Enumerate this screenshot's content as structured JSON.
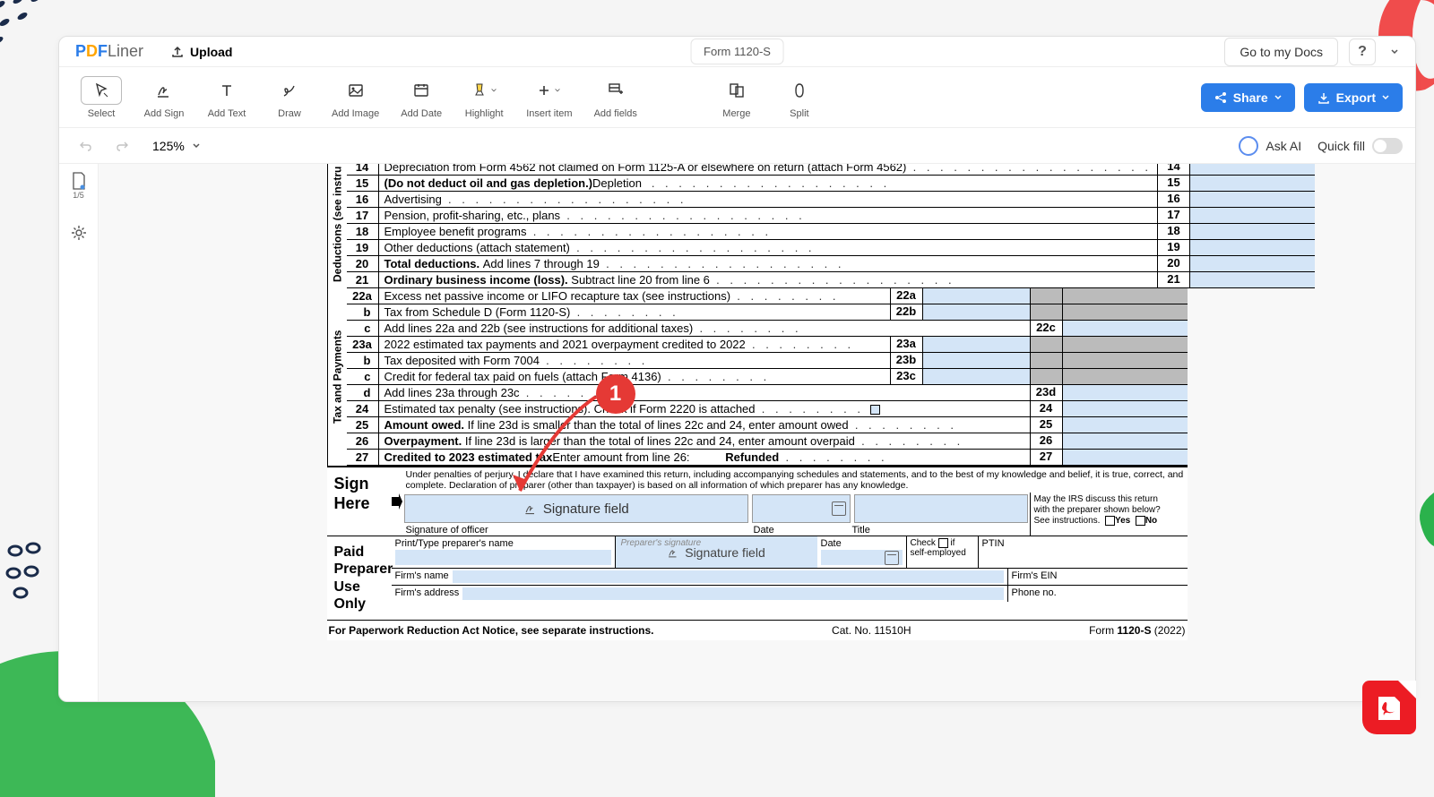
{
  "brand": {
    "p": "P",
    "d": "D",
    "f": "F",
    "liner": "Liner"
  },
  "topbar": {
    "upload": "Upload",
    "doc_title": "Form 1120-S",
    "go_docs": "Go to my Docs",
    "help": "?"
  },
  "toolbar": {
    "select": "Select",
    "add_sign": "Add Sign",
    "add_text": "Add Text",
    "draw": "Draw",
    "add_image": "Add Image",
    "add_date": "Add Date",
    "highlight": "Highlight",
    "insert_item": "Insert item",
    "add_fields": "Add fields",
    "merge": "Merge",
    "split": "Split",
    "share": "Share",
    "export": "Export"
  },
  "subbar": {
    "zoom": "125%",
    "ask_ai": "Ask AI",
    "quickfill": "Quick fill"
  },
  "leftbar": {
    "page_indicator": "1/5"
  },
  "form": {
    "sections": {
      "deductions": "Deductions  (see instru",
      "tax": "Tax and Payments"
    },
    "lines": [
      {
        "n": "14",
        "t": "Depreciation from Form 4562 not claimed on Form 1125-A or elsewhere on return (attach Form 4562)",
        "r": "14"
      },
      {
        "n": "15",
        "t": "Depletion ",
        "b": "(Do not deduct oil and gas depletion.)",
        "r": "15"
      },
      {
        "n": "16",
        "t": "Advertising",
        "r": "16"
      },
      {
        "n": "17",
        "t": "Pension, profit-sharing, etc., plans",
        "r": "17"
      },
      {
        "n": "18",
        "t": "Employee benefit programs",
        "r": "18"
      },
      {
        "n": "19",
        "t": "Other deductions (attach statement)",
        "r": "19"
      },
      {
        "n": "20",
        "b": "Total deductions. ",
        "t": "Add lines 7 through 19",
        "r": "20"
      },
      {
        "n": "21",
        "b": "Ordinary business income (loss). ",
        "t": "Subtract line 20 from line 6",
        "r": "21"
      }
    ],
    "tax_lines": [
      {
        "n": "22a",
        "t": "Excess net passive income or LIFO recapture tax (see instructions)",
        "r": "22a",
        "sm": true
      },
      {
        "n": "b",
        "sub": true,
        "t": "Tax from Schedule D (Form 1120-S)",
        "r": "22b",
        "sm": true
      },
      {
        "n": "c",
        "sub": true,
        "t": "Add lines 22a and 22b (see instructions for additional taxes)",
        "r": "22c"
      },
      {
        "n": "23a",
        "t": "2022 estimated tax payments and 2021 overpayment credited to 2022",
        "r": "23a",
        "sm": true
      },
      {
        "n": "b",
        "sub": true,
        "t": "Tax deposited with Form 7004",
        "r": "23b",
        "sm": true
      },
      {
        "n": "c",
        "sub": true,
        "t": "Credit for federal tax paid on fuels (attach Form 4136)",
        "r": "23c",
        "sm": true
      },
      {
        "n": "d",
        "sub": true,
        "t": "Add lines 23a through 23c",
        "r": "23d"
      },
      {
        "n": "24",
        "t": "Estimated tax penalty (see instructions). Check if Form 2220 is attached",
        "r": "24",
        "chk": true
      },
      {
        "n": "25",
        "b": "Amount owed. ",
        "t": "If line 23d is smaller than the total of lines 22c and 24, enter amount owed",
        "r": "25"
      },
      {
        "n": "26",
        "b": "Overpayment. ",
        "t": "If line 23d is larger than the total of lines 22c and 24, enter amount overpaid",
        "r": "26"
      },
      {
        "n": "27",
        "t": "Enter amount from line 26:   ",
        "b": "Credited to 2023 estimated tax",
        "t2": "Refunded",
        "r": "27"
      }
    ],
    "sign": {
      "label1": "Sign",
      "label2": "Here",
      "penalty": "Under penalties of perjury, I declare that I have examined this return, including accompanying schedules and statements, and to the best of my knowledge and belief, it is true, correct, and complete. Declaration of preparer (other than taxpayer) is based on all information of which preparer has any knowledge.",
      "sig_field": "Signature field",
      "sig_officer": "Signature of officer",
      "date": "Date",
      "title": "Title",
      "irs1": "May the IRS discuss this return",
      "irs2": "with the preparer shown below?",
      "irs3": "See instructions.",
      "yes": "Yes",
      "no": "No"
    },
    "prep": {
      "label1": "Paid",
      "label2": "Preparer",
      "label3": "Use Only",
      "print_name": "Print/Type preparer's name",
      "prep_sig_ph": "Preparer's signature",
      "sig_field": "Signature field",
      "date": "Date",
      "check": "Check",
      "if": "if",
      "self": "self-employed",
      "ptin": "PTIN",
      "firm_name": "Firm's name",
      "firm_ein": "Firm's EIN",
      "firm_addr": "Firm's address",
      "phone": "Phone no."
    },
    "footer": {
      "left": "For Paperwork Reduction Act Notice, see separate instructions.",
      "mid": "Cat. No. 11510H",
      "right_pre": "Form ",
      "right_b": "1120-S",
      "right_post": " (2022)"
    }
  },
  "annotation": {
    "number": "1"
  }
}
